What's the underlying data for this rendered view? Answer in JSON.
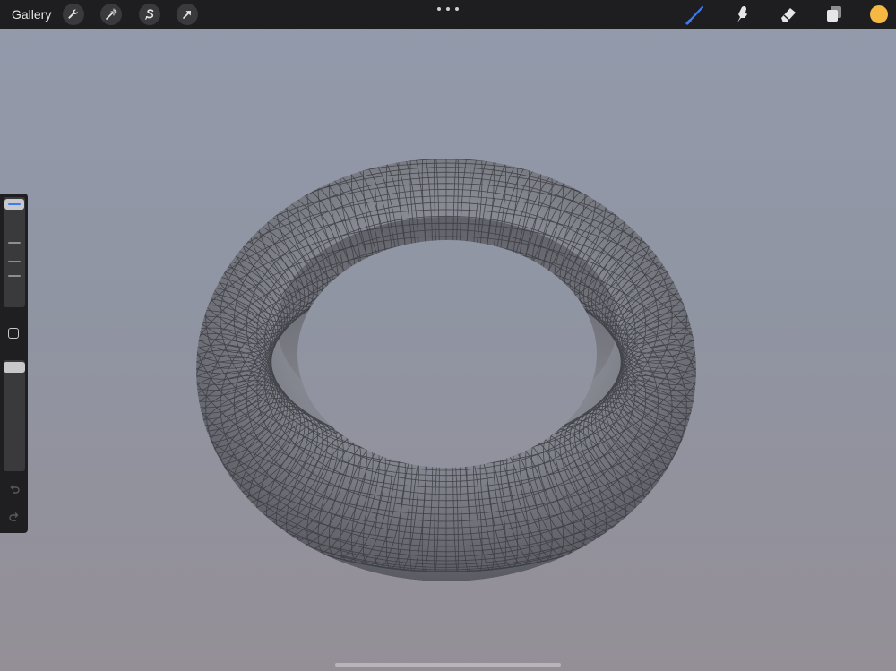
{
  "topbar": {
    "gallery_label": "Gallery",
    "left_tools": [
      {
        "name": "actions",
        "icon": "wrench-icon"
      },
      {
        "name": "adjustments",
        "icon": "magic-wand-icon"
      },
      {
        "name": "selection",
        "icon": "selection-s-icon"
      },
      {
        "name": "transform",
        "icon": "arrow-cursor-icon"
      }
    ],
    "right_tools": [
      {
        "name": "brush",
        "icon": "brush-icon",
        "active": true
      },
      {
        "name": "smudge",
        "icon": "smudge-finger-icon"
      },
      {
        "name": "eraser",
        "icon": "eraser-icon"
      },
      {
        "name": "layers",
        "icon": "layers-icon"
      }
    ],
    "more_icon": "ellipsis-icon"
  },
  "colors": {
    "active_tool": "#3d7bf5",
    "current_color": "#f5b943",
    "topbar_bg": "#1e1e20",
    "canvas_bg_top": "#939aab",
    "canvas_bg_bottom": "#948f97"
  },
  "sidebar": {
    "brush_size_value": 1.0,
    "brush_opacity_value": 1.0,
    "modify_icon": "square-modify-icon",
    "undo_icon": "undo-icon",
    "redo_icon": "redo-icon"
  },
  "canvas": {
    "subject": "torus-wireframe"
  }
}
